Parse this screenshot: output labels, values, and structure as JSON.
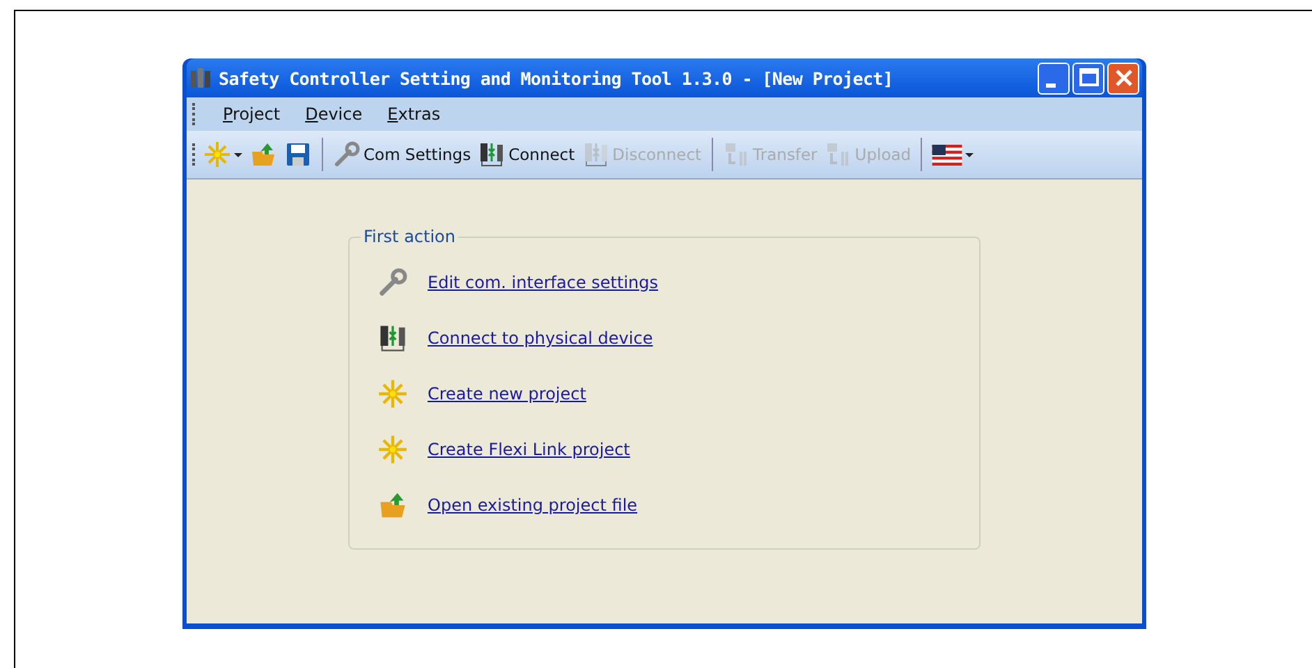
{
  "window": {
    "title": "Safety Controller Setting and Monitoring Tool 1.3.0 - [New Project]"
  },
  "menu": [
    {
      "label": "Project"
    },
    {
      "label": "Device"
    },
    {
      "label": "Extras"
    }
  ],
  "toolbar": [
    {
      "kind": "star",
      "dropdown": true,
      "disabled": false
    },
    {
      "kind": "folder",
      "dropdown": false,
      "disabled": false
    },
    {
      "kind": "save",
      "dropdown": false,
      "disabled": false
    },
    {
      "kind": "separator"
    },
    {
      "kind": "wrench",
      "label": "Com Settings",
      "dropdown": false,
      "disabled": false
    },
    {
      "kind": "connect",
      "label": "Connect",
      "dropdown": false,
      "disabled": false
    },
    {
      "kind": "connect",
      "label": "Disconnect",
      "dropdown": false,
      "disabled": true
    },
    {
      "kind": "separator"
    },
    {
      "kind": "transfer",
      "label": "Transfer",
      "dropdown": false,
      "disabled": true
    },
    {
      "kind": "transfer",
      "label": "Upload",
      "dropdown": false,
      "disabled": true
    },
    {
      "kind": "separator"
    },
    {
      "kind": "flag",
      "dropdown": true,
      "disabled": false
    }
  ],
  "first_action": {
    "title": "First action",
    "links": [
      {
        "kind": "wrench",
        "label": "Edit com. interface settings"
      },
      {
        "kind": "connect",
        "label": "Connect to physical device"
      },
      {
        "kind": "star",
        "label": "Create new project"
      },
      {
        "kind": "star",
        "label": "Create Flexi Link project"
      },
      {
        "kind": "folder",
        "label": "Open existing project file"
      }
    ]
  }
}
